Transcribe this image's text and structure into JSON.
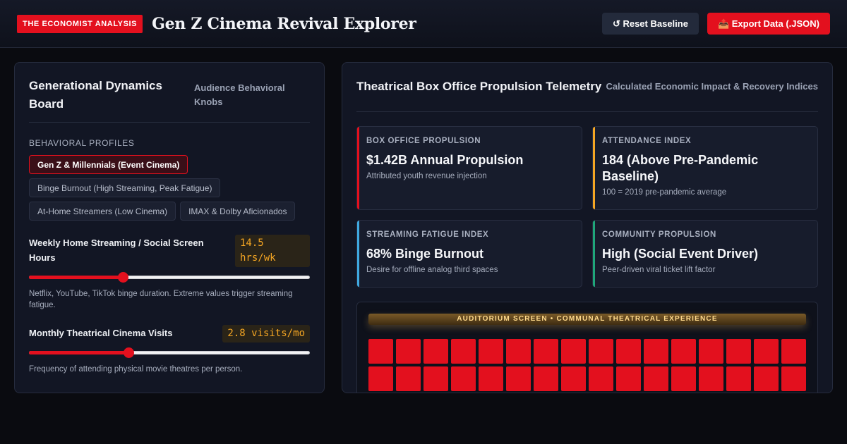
{
  "header": {
    "badge": "THE ECONOMIST ANALYSIS",
    "title": "Gen Z Cinema Revival Explorer",
    "reset_label": "↺ Reset Baseline",
    "export_label": "📤 Export Data (.JSON)"
  },
  "left_panel": {
    "title": "Generational Dynamics Board",
    "subtitle": "Audience Behavioral Knobs",
    "profiles_label": "BEHAVIORAL PROFILES",
    "profiles": [
      {
        "label": "Gen Z & Millennials (Event Cinema)",
        "active": true
      },
      {
        "label": "Binge Burnout (High Streaming, Peak Fatigue)",
        "active": false
      },
      {
        "label": "At-Home Streamers (Low Cinema)",
        "active": false
      },
      {
        "label": "IMAX & Dolby Aficionados",
        "active": false
      }
    ],
    "sliders": [
      {
        "label": "Weekly Home Streaming / Social Screen Hours",
        "value_text": "14.5 hrs/wk",
        "fraction": 0.335,
        "help": "Netflix, YouTube, TikTok binge duration. Extreme values trigger streaming fatigue."
      },
      {
        "label": "Monthly Theatrical Cinema Visits",
        "value_text": "2.8 visits/mo",
        "fraction": 0.355,
        "help": "Frequency of attending physical movie theatres per person."
      }
    ]
  },
  "right_panel": {
    "title": "Theatrical Box Office Propulsion Telemetry",
    "subtitle": "Calculated Economic Impact & Recovery Indices",
    "metrics": [
      {
        "label": "BOX OFFICE PROPULSION",
        "value": "$1.42B Annual Propulsion",
        "desc": "Attributed youth revenue injection",
        "accent": "#e3101e"
      },
      {
        "label": "ATTENDANCE INDEX",
        "value": "184 (Above Pre-Pandemic Baseline)",
        "desc": "100 = 2019 pre-pandemic average",
        "accent": "#f5a623"
      },
      {
        "label": "STREAMING FATIGUE INDEX",
        "value": "68% Binge Burnout",
        "desc": "Desire for offline analog third spaces",
        "accent": "#3fa9e0"
      },
      {
        "label": "COMMUNITY PROPULSION",
        "value": "High (Social Event Driver)",
        "desc": "Peer-driven viral ticket lift factor",
        "accent": "#1fa67a"
      }
    ],
    "auditorium": {
      "screen_label": "AUDITORIUM SCREEN • COMMUNAL THEATRICAL EXPERIENCE",
      "seat_color": "#e3101e"
    }
  }
}
